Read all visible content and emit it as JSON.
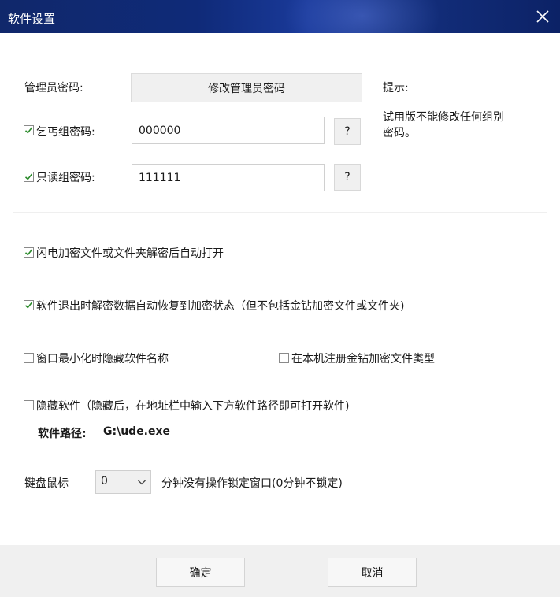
{
  "window": {
    "title": "软件设置"
  },
  "admin": {
    "label": "管理员密码:",
    "change_button": "修改管理员密码"
  },
  "hint": {
    "title": "提示:",
    "text_line1": "试用版不能修改任何组别",
    "text_line2": "密码。"
  },
  "beggar_group": {
    "label": "乞丐组密码:",
    "checked": true,
    "value": "000000",
    "help": "?"
  },
  "readonly_group": {
    "label": "只读组密码:",
    "checked": true,
    "value": "111111",
    "help": "?"
  },
  "options": {
    "flash_open": {
      "label": "闪电加密文件或文件夹解密后自动打开",
      "checked": true
    },
    "restore_on_exit": {
      "label": "软件退出时解密数据自动恢复到加密状态（但不包括金钻加密文件或文件夹)",
      "checked": true
    },
    "hide_name_minimized": {
      "label": "窗口最小化时隐藏软件名称",
      "checked": false
    },
    "register_type": {
      "label": "在本机注册金钻加密文件类型",
      "checked": false
    },
    "hide_software": {
      "label": "隐藏软件（隐藏后，在地址栏中输入下方软件路径即可打开软件)",
      "checked": false
    }
  },
  "path": {
    "label": "软件路径:",
    "value": "G:\\ude.exe"
  },
  "lock": {
    "label": "键盘鼠标",
    "selected": "0",
    "suffix": "分钟没有操作锁定窗口(0分钟不锁定)"
  },
  "footer": {
    "ok": "确定",
    "cancel": "取消"
  },
  "colors": {
    "titlebar": "#10286b",
    "check": "#2a8a2a"
  }
}
